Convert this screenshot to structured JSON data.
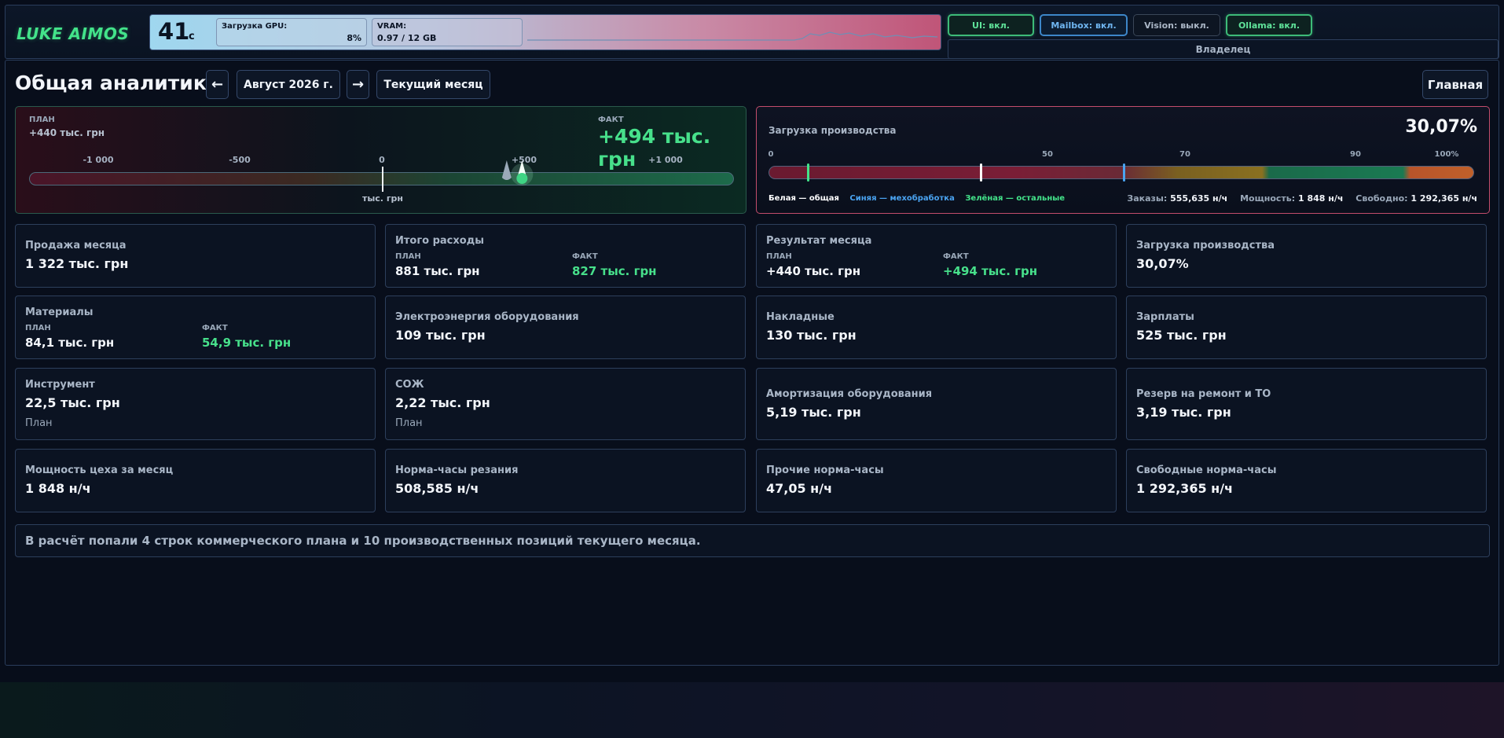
{
  "app": {
    "logo": "LUKE AIMOS"
  },
  "system": {
    "temperature": "41",
    "temperature_unit": "c",
    "gpu_label": "Загрузка GPU:",
    "gpu_value": "8%",
    "vram_label": "VRAM:",
    "vram_value": "0.97 / 12 GB",
    "services": [
      {
        "label": "UI: вкл.",
        "state": "on"
      },
      {
        "label": "Mailbox: вкл.",
        "state": "on"
      },
      {
        "label": "Vision: выкл.",
        "state": "off"
      },
      {
        "label": "Ollama: вкл.",
        "state": "on"
      }
    ],
    "user_role": "Владелец"
  },
  "header": {
    "title": "Общая аналитика",
    "prev_icon": "←",
    "period": "Август 2026 г.",
    "next_icon": "→",
    "current_month_label": "Текущий месяц",
    "home_label": "Главная"
  },
  "plan_fact": {
    "plan_caption": "ПЛАН",
    "plan_value": "+440 тыс. грн",
    "fact_caption": "ФАКТ",
    "fact_value": "+494 тыс. грн",
    "ticks": [
      "-1 000",
      "-500",
      "0",
      "+500",
      "+1 000"
    ],
    "unit": "тыс. грн",
    "plan_marker": 440,
    "fact_marker": 494
  },
  "production_load": {
    "title": "Загрузка производства",
    "percent": "30,07%",
    "ticks": [
      "0",
      "50",
      "70",
      "90",
      "100%"
    ],
    "legend_white": "Белая — общая",
    "legend_blue": "Синяя — мехобработка",
    "legend_green": "Зелёная — остальные",
    "orders_label": "Заказы:",
    "orders_value": "555,635 н/ч",
    "capacity_label": "Мощность:",
    "capacity_value": "1 848 н/ч",
    "free_label": "Свободно:",
    "free_value": "1 292,365 н/ч",
    "marker_white": 30.07,
    "marker_blue": 50.4,
    "marker_green": 5.6
  },
  "cards": {
    "sales": {
      "title": "Продажа месяца",
      "value": "1 322 тыс. грн"
    },
    "expenses": {
      "title": "Итого расходы",
      "plan_caption": "ПЛАН",
      "plan_value": "881 тыс. грн",
      "fact_caption": "ФАКТ",
      "fact_value": "827 тыс. грн"
    },
    "result": {
      "title": "Результат месяца",
      "plan_caption": "ПЛАН",
      "plan_value": "+440 тыс. грн",
      "fact_caption": "ФАКТ",
      "fact_value": "+494 тыс. грн"
    },
    "load": {
      "title": "Загрузка производства",
      "value": "30,07%"
    },
    "materials": {
      "title": "Материалы",
      "plan_caption": "ПЛАН",
      "plan_value": "84,1 тыс. грн",
      "fact_caption": "ФАКТ",
      "fact_value": "54,9 тыс. грн"
    },
    "electricity": {
      "title": "Электроэнергия оборудования",
      "value": "109 тыс. грн"
    },
    "overhead": {
      "title": "Накладные",
      "value": "130 тыс. грн"
    },
    "salaries": {
      "title": "Зарплаты",
      "value": "525 тыс. грн"
    },
    "tools": {
      "title": "Инструмент",
      "value": "22,5 тыс. грн",
      "sub": "План"
    },
    "coolant": {
      "title": "СОЖ",
      "value": "2,22 тыс. грн",
      "sub": "План"
    },
    "depreciation": {
      "title": "Амортизация оборудования",
      "value": "5,19 тыс. грн"
    },
    "reserve": {
      "title": "Резерв на ремонт и ТО",
      "value": "3,19 тыс. грн"
    },
    "capacity": {
      "title": "Мощность цеха за месяц",
      "value": "1 848 н/ч"
    },
    "cutting_hours": {
      "title": "Норма-часы резания",
      "value": "508,585 н/ч"
    },
    "other_hours": {
      "title": "Прочие норма-часы",
      "value": "47,05 н/ч"
    },
    "free_hours": {
      "title": "Свободные норма-часы",
      "value": "1 292,365 н/ч"
    }
  },
  "note": "В расчёт попали 4 строк коммерческого плана и 10 производственных позиций текущего месяца.",
  "colors": {
    "accent_green": "#47e08b",
    "accent_red": "#c34d6c",
    "accent_blue": "#3d86c8"
  }
}
